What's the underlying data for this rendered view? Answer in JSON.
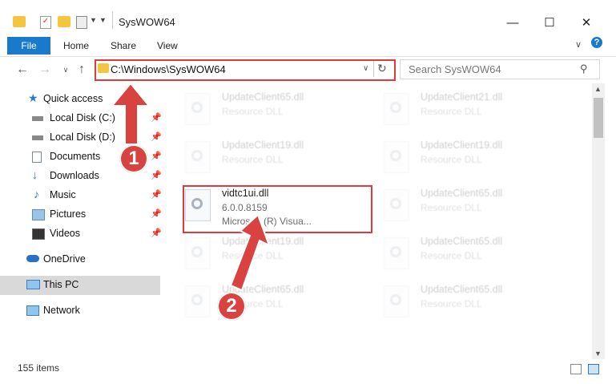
{
  "window": {
    "title": "SysWOW64"
  },
  "ribbon": {
    "tabs": [
      "File",
      "Home",
      "Share",
      "View"
    ]
  },
  "address": {
    "path": "C:\\Windows\\SysWOW64"
  },
  "search": {
    "placeholder": "Search SysWOW64"
  },
  "nav": {
    "quick_access": "Quick access",
    "items": [
      {
        "label": "Local Disk (C:)"
      },
      {
        "label": "Local Disk (D:)"
      },
      {
        "label": "Documents"
      },
      {
        "label": "Downloads"
      },
      {
        "label": "Music"
      },
      {
        "label": "Pictures"
      },
      {
        "label": "Videos"
      }
    ],
    "onedrive": "OneDrive",
    "this_pc": "This PC",
    "network": "Network"
  },
  "files": {
    "left": [
      {
        "name": "UpdateClient65.dll",
        "type": "Resource DLL"
      },
      {
        "name": "UpdateClient19.dll",
        "type": "Resource DLL"
      },
      {
        "name": "vidtc1ui.dll",
        "version": "6.0.0.8159",
        "company": "Microsoft (R) Visua..."
      },
      {
        "name": "UpdateClient19.dll",
        "type": "Resource DLL"
      },
      {
        "name": "UpdateClient65.dll",
        "type": "Resource DLL"
      }
    ],
    "right": [
      {
        "name": "UpdateClient21.dll",
        "type": "Resource DLL"
      },
      {
        "name": "UpdateClient19.dll",
        "type": "Resource DLL"
      },
      {
        "name": "UpdateClient65.dll",
        "type": "Resource DLL"
      },
      {
        "name": "UpdateClient65.dll",
        "type": "Resource DLL"
      },
      {
        "name": "UpdateClient65.dll",
        "type": "Resource DLL"
      }
    ]
  },
  "callouts": [
    "1",
    "2"
  ],
  "status": {
    "count": "155 items"
  },
  "colors": {
    "accent": "#1979ca",
    "highlight": "#e03a3a",
    "callout": "#d8423f"
  }
}
